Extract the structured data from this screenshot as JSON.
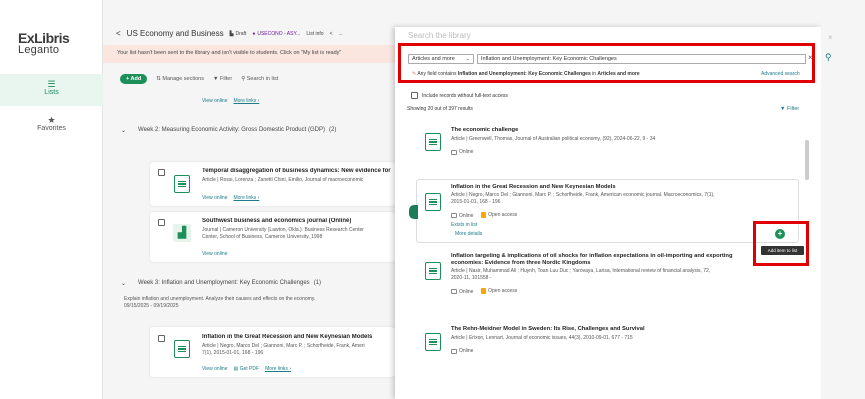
{
  "brand": {
    "line1": "ExLibris",
    "line2": "Leganto"
  },
  "rail": {
    "lists_label": "Lists",
    "favorites_label": "Favorites"
  },
  "header": {
    "back": "<",
    "title": "US Economy and Business",
    "draft": "Draft",
    "course": "USECONO - ASY...",
    "list_info": "List info",
    "more": "..."
  },
  "notice": "Your list hasn't been sent to the library and isn't visible to students. Click on \"My list is ready\"",
  "toolbar": {
    "add": "+ Add",
    "manage": "Manage sections",
    "filter": "Filter",
    "search": "Search in list"
  },
  "list": {
    "top_links": {
      "view_online": "View online",
      "more_links": "More links ›"
    },
    "week2": "Week 2: Measuring Economic Activity: Gross Domestic Product (GDP)",
    "week2_count": "(2)",
    "item1": {
      "title": "Temporal disaggregation of business dynamics: New evidence for",
      "meta": "Article  |  Rossi, Lorenza ; Zanetti Chini, Emilio, Journal of macroeconomic",
      "view_online": "View online",
      "more_links": "More links ›"
    },
    "item2": {
      "title": "Southwest business and economics journal (Online)",
      "meta1": "Journal  |  Cameron University (Lawton, Okla.). Business Research Center",
      "meta2": "Center, School of Business, Cameron University, 1998",
      "view_online": "View online"
    },
    "week3": "Week 3: Inflation and Unemployment: Key Economic Challenges",
    "week3_count": "(1)",
    "week3_desc": "Explain inflation and unemployment. Analyze their causes and effects on the economy.",
    "week3_dates": "09/15/2025 - 09/19/2025",
    "item3": {
      "title": "Inflation in the Great Recession and New Keynesian Models",
      "meta1": "Article  |  Negro, Marco Del ; Giannoni, Marc P. ; Schorfheide, Frank, Ameri",
      "meta2": "7(1), 2015-01-01, 168 - 196",
      "view_online": "View online",
      "get_pdf": "Get PDF",
      "more_links": "More links ›"
    }
  },
  "panel": {
    "title": "Search the library",
    "close": "×",
    "scope": "Articles and more",
    "query": "Inflation and Unemployment: Key Economic Challenges",
    "hint_prefix": "Any field contains",
    "hint_query": "Inflation and Unemployment: Key Economic Challenges",
    "hint_mid": "in",
    "hint_scope": "Articles and more",
    "advanced": "Advanced search",
    "include_label": "Include records without full-text access",
    "showing": "Showing 20 out of 397 results",
    "filter": "Filter",
    "add_tooltip": "Add item to list"
  },
  "results": [
    {
      "title": "The economic challenge",
      "meta": "Article  |  Greenwell, Thomas, Journal of Australian political economy, (92), 2024-06-22, 9 - 34",
      "tags": [
        "Online"
      ]
    },
    {
      "title": "Inflation in the Great Recession and New Keynesian Models",
      "meta1": "Article  |  Negro, Marco Del ; Giannoni, Marc P. ; Schorfheide, Frank, American economic journal. Macroeconomics, 7(1),",
      "meta2": "2015-01-01, 168 - 196",
      "tags": [
        "Online",
        "Open access"
      ],
      "exists": "Exists in list",
      "more": "More details"
    },
    {
      "title1": "Inflation targeting & implications of oil shocks for inflation expectations in oil-importing and exporting",
      "title2": "economies: Evidence from three Nordic Kingdoms",
      "meta1": "Article  |  Nasir, Muhammad Ali ; Huynh, Toan Luu Duc ; Yarovaya, Larisa, International review of financial analysis, 72,",
      "meta2": "2020-11, 101558 -",
      "tags": [
        "Online",
        "Open access"
      ]
    },
    {
      "title": "The Rehn-Meidner Model in Sweden: Its Rise, Challenges and Survival",
      "meta": "Article  |  Erixon, Lennart, Journal of economic issues, 44(3), 2010-09-01, 677 - 715",
      "tags": [
        "Online"
      ]
    }
  ],
  "colors": {
    "accent": "#1c8f5a",
    "link": "#1c7c8a",
    "highlight": "#e10000",
    "notice_bg": "#fbe6df"
  }
}
